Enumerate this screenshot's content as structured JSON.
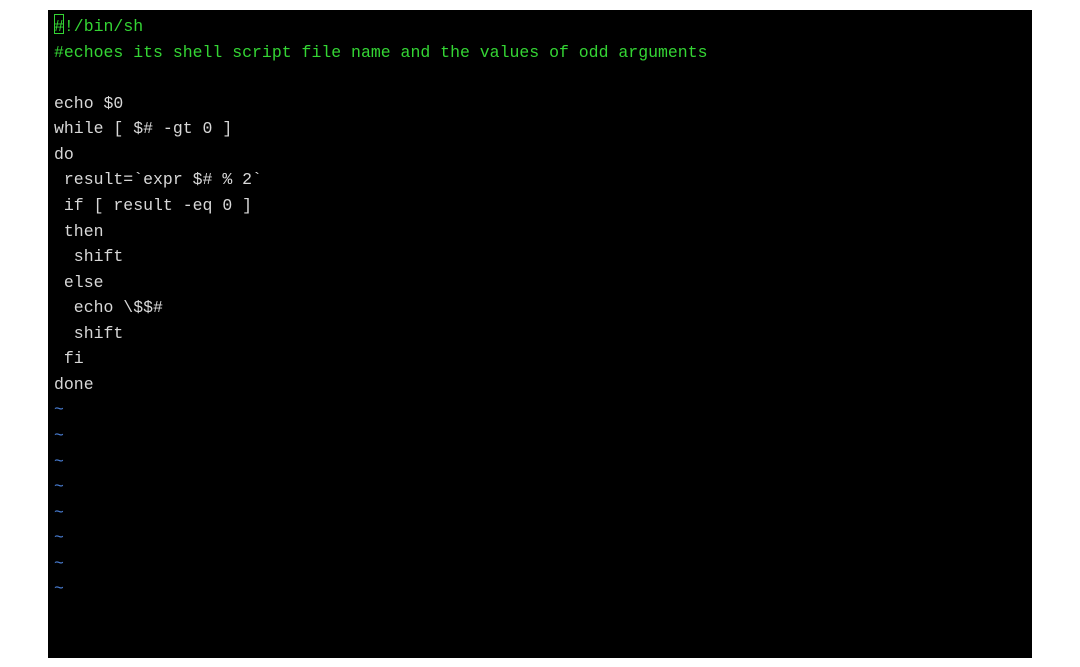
{
  "editor": {
    "lines": [
      {
        "parts": [
          {
            "text": "#",
            "cls": "green cursor-target"
          },
          {
            "text": "!/bin/sh",
            "cls": "green"
          }
        ]
      },
      {
        "parts": [
          {
            "text": "#echoes its shell script file name and the values of odd arguments",
            "cls": "green"
          }
        ]
      },
      {
        "parts": [
          {
            "text": "",
            "cls": ""
          }
        ]
      },
      {
        "parts": [
          {
            "text": "echo $0",
            "cls": ""
          }
        ]
      },
      {
        "parts": [
          {
            "text": "while [ $# -gt 0 ]",
            "cls": ""
          }
        ]
      },
      {
        "parts": [
          {
            "text": "do",
            "cls": ""
          }
        ]
      },
      {
        "parts": [
          {
            "text": " result=`expr $# % 2`",
            "cls": ""
          }
        ]
      },
      {
        "parts": [
          {
            "text": " if [ result -eq 0 ]",
            "cls": ""
          }
        ]
      },
      {
        "parts": [
          {
            "text": " then",
            "cls": ""
          }
        ]
      },
      {
        "parts": [
          {
            "text": "  shift",
            "cls": ""
          }
        ]
      },
      {
        "parts": [
          {
            "text": " else",
            "cls": ""
          }
        ]
      },
      {
        "parts": [
          {
            "text": "  echo \\$$#",
            "cls": ""
          }
        ]
      },
      {
        "parts": [
          {
            "text": "  shift",
            "cls": ""
          }
        ]
      },
      {
        "parts": [
          {
            "text": " fi",
            "cls": ""
          }
        ]
      },
      {
        "parts": [
          {
            "text": "done",
            "cls": ""
          }
        ]
      },
      {
        "parts": [
          {
            "text": "~",
            "cls": "blue"
          }
        ]
      },
      {
        "parts": [
          {
            "text": "~",
            "cls": "blue"
          }
        ]
      },
      {
        "parts": [
          {
            "text": "~",
            "cls": "blue"
          }
        ]
      },
      {
        "parts": [
          {
            "text": "~",
            "cls": "blue"
          }
        ]
      },
      {
        "parts": [
          {
            "text": "~",
            "cls": "blue"
          }
        ]
      },
      {
        "parts": [
          {
            "text": "~",
            "cls": "blue"
          }
        ]
      },
      {
        "parts": [
          {
            "text": "~",
            "cls": "blue"
          }
        ]
      },
      {
        "parts": [
          {
            "text": "~",
            "cls": "blue"
          }
        ]
      }
    ]
  }
}
